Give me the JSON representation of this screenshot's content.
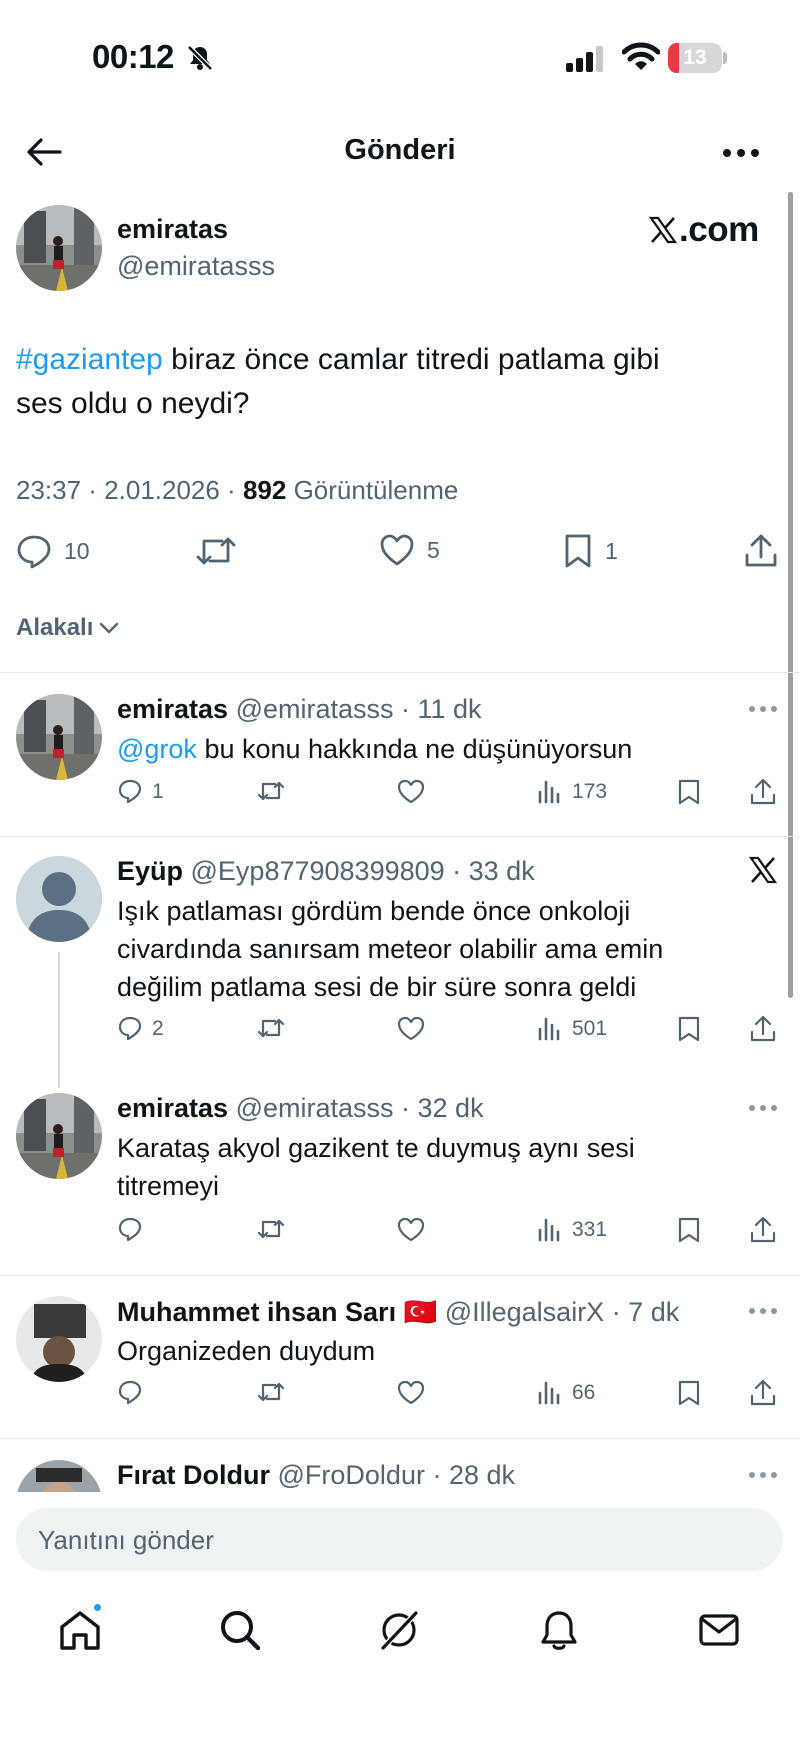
{
  "status_bar": {
    "time": "00:12",
    "battery": "13",
    "battery_level": 0.13
  },
  "header": {
    "title": "Gönderi"
  },
  "main_post": {
    "name": "emiratas",
    "handle": "@emiratasss",
    "logo_text": ".com",
    "hashtag": "#gaziantep",
    "text_line1": " biraz önce camlar titredi patlama gibi",
    "text_line2": "ses oldu o neydi?",
    "time": "23:37 · 2.01.2026 · ",
    "views": "892",
    "views_label": " Görüntülenme",
    "replies": "10",
    "likes": "5",
    "bookmarks": "1"
  },
  "sort": {
    "label": "Alakalı"
  },
  "replies": [
    {
      "name": "emiratas",
      "meta": " @emiratasss · 11 dk",
      "mention": "@grok",
      "text": " bu konu hakkında ne düşünüyorsun",
      "reply_count": "1",
      "views": "173"
    },
    {
      "name": "Eyüp",
      "meta": " @Eyp877908399809 · 33 dk",
      "text_lines": [
        "Işık patlaması gördüm bende önce onkoloji",
        "civardında sanırsam meteor olabilir ama emin",
        "değilim patlama sesi de bir süre sonra geldi"
      ],
      "reply_count": "2",
      "views": "501"
    },
    {
      "name": "emiratas",
      "meta": " @emiratasss · 32 dk",
      "text_lines": [
        "Karataş akyol gazikent te duymuş aynı sesi",
        "titremeyi"
      ],
      "views": "331"
    },
    {
      "name": "Muhammet ihsan Sarı",
      "flag": "🇹🇷",
      "meta": " @IllegalsairX · 7 dk",
      "text": "Organizeden duydum",
      "views": "66"
    },
    {
      "name": "Fırat Doldur",
      "meta": " @FroDoldur · 28 dk"
    }
  ],
  "compose": {
    "placeholder": "Yanıtını gönder"
  },
  "icons": [
    "bell-off-icon",
    "signal-icon",
    "wifi-icon",
    "back-arrow-icon",
    "more-icon",
    "x-logo-icon",
    "reply-icon",
    "repost-icon",
    "like-icon",
    "bookmark-icon",
    "share-icon",
    "views-icon",
    "chevron-down-icon",
    "home-icon",
    "search-icon",
    "grok-icon",
    "notifications-icon",
    "messages-icon"
  ],
  "colors": {
    "accent": "#1d9bf0",
    "text": "#0f1419",
    "secondary": "#536471",
    "battery_low": "#ea3943"
  }
}
